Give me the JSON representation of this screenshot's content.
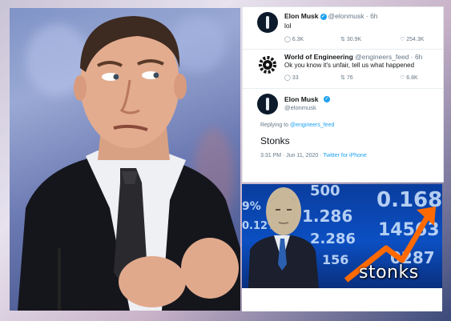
{
  "tweet1": {
    "name": "Elon Musk",
    "handle": "@elonmusk · 6h",
    "text": "lol",
    "replies": "6.3K",
    "retweets": "30.9K",
    "likes": "254.3K"
  },
  "tweet2": {
    "name": "World of Engineering",
    "handle": "@engineers_feed · 6h",
    "text": "Ok you know it's unfair, tell us what happened",
    "replies": "33",
    "retweets": "76",
    "likes": "6.8K"
  },
  "tweet3": {
    "name": "Elon Musk",
    "handle": "@elonmusk",
    "replying_prefix": "Replying to",
    "replying_to": "@engineers_feed",
    "text": "Stonks",
    "timestamp": "3:31 PM · Jun 11, 2020 · ",
    "client": "Twitter for iPhone"
  },
  "meme": {
    "caption": "stonks",
    "tickers": [
      "500",
      "9%",
      "1.286",
      "0.168",
      "0.12%",
      "2.286",
      "14563",
      "156",
      "0287"
    ]
  },
  "colors": {
    "twitter_blue": "#1da1f2",
    "meme_bg": "#0b4fc2",
    "arrow": "#ff6a00"
  }
}
